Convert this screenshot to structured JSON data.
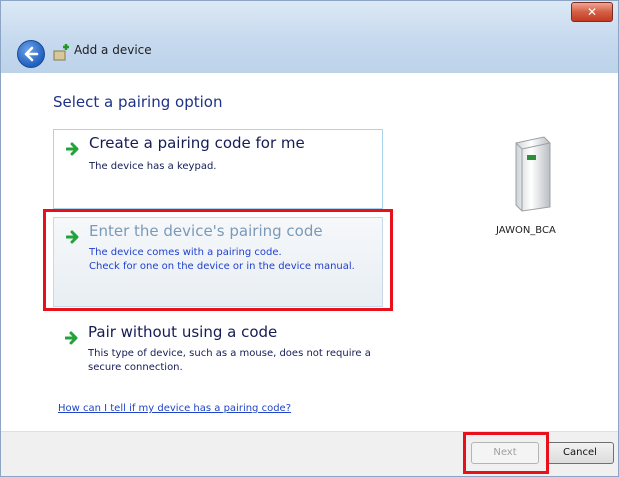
{
  "window": {
    "title": "Add a device",
    "close_glyph": "✕"
  },
  "heading": "Select a pairing option",
  "options": [
    {
      "title": "Create a pairing code for me",
      "desc": [
        "The device has a keypad."
      ]
    },
    {
      "title": "Enter the device's pairing code",
      "desc": [
        "The device comes with a pairing code.",
        "Check for one on the device or in the device manual."
      ]
    },
    {
      "title": "Pair without using a code",
      "desc": [
        "This type of device, such as a mouse, does not require a",
        "secure connection."
      ]
    }
  ],
  "device": {
    "name": "JAWON_BCA",
    "icon": "computer-tower-icon"
  },
  "help_link": "How can I tell if my device has a pairing code?",
  "buttons": {
    "next": "Next",
    "cancel": "Cancel"
  },
  "colors": {
    "highlight": "#e8101a",
    "link": "#1f44c8",
    "heading": "#1e3287"
  }
}
